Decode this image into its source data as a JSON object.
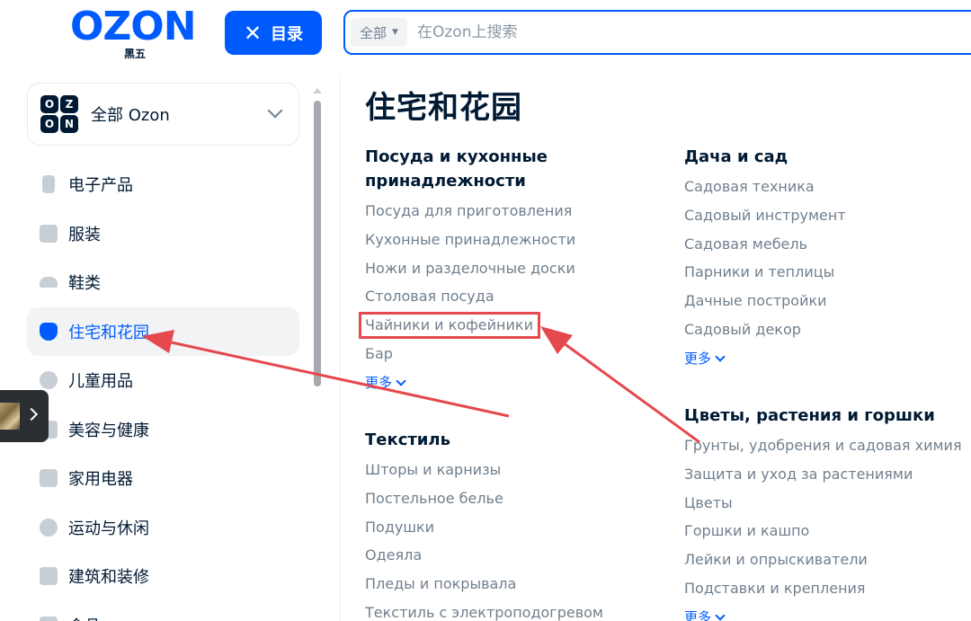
{
  "header": {
    "logo_text": "OZON",
    "logo_sub": "黑五",
    "catalog_button": "目录",
    "search_scope": "全部",
    "search_placeholder": "在Ozon上搜索"
  },
  "sidebar": {
    "all_ozon": {
      "logo_letters": [
        "O",
        "Z",
        "O",
        "N"
      ],
      "label": "全部 Ozon"
    },
    "items": [
      {
        "label": "电子产品",
        "icon": "phone-icon",
        "active": false
      },
      {
        "label": "服装",
        "icon": "shirt-icon",
        "active": false
      },
      {
        "label": "鞋类",
        "icon": "shoe-icon",
        "active": false
      },
      {
        "label": "住宅和花园",
        "icon": "plant-icon",
        "active": true
      },
      {
        "label": "儿童用品",
        "icon": "toy-icon",
        "active": false
      },
      {
        "label": "美容与健康",
        "icon": "cosmetics-icon",
        "active": false
      },
      {
        "label": "家用电器",
        "icon": "appliance-icon",
        "active": false
      },
      {
        "label": "运动与休闲",
        "icon": "sport-icon",
        "active": false
      },
      {
        "label": "建筑和装修",
        "icon": "tools-icon",
        "active": false
      },
      {
        "label": "食品",
        "icon": "food-icon",
        "active": false
      }
    ]
  },
  "main": {
    "title": "住宅和花园",
    "groups": [
      {
        "title": "Посуда и кухонные принадлежности",
        "links": [
          "Посуда для приготовления",
          "Кухонные принадлежности",
          "Ножи и разделочные доски",
          "Столовая посуда",
          "Чайники и кофейники",
          "Бар"
        ],
        "more": "更多"
      },
      {
        "title": "Текстиль",
        "links": [
          "Шторы и карнизы",
          "Постельное белье",
          "Подушки",
          "Одеяла",
          "Пледы и покрывала",
          "Текстиль с электроподогревом"
        ]
      },
      {
        "title": "Дача и сад",
        "links": [
          "Садовая техника",
          "Садовый инструмент",
          "Садовая мебель",
          "Парники и теплицы",
          "Дачные постройки",
          "Садовый декор"
        ],
        "more": "更多"
      },
      {
        "title": "Цветы, растения и горшки",
        "links": [
          "Грунты, удобрения и садовая химия",
          "Защита и уход за растениями",
          "Цветы",
          "Горшки и кашпо",
          "Лейки и опрыскиватели",
          "Подставки и крепления"
        ],
        "more": "更多"
      }
    ]
  },
  "annotation": {
    "color": "#e5484d",
    "highlighted_link": "Чайники и кофейники"
  }
}
